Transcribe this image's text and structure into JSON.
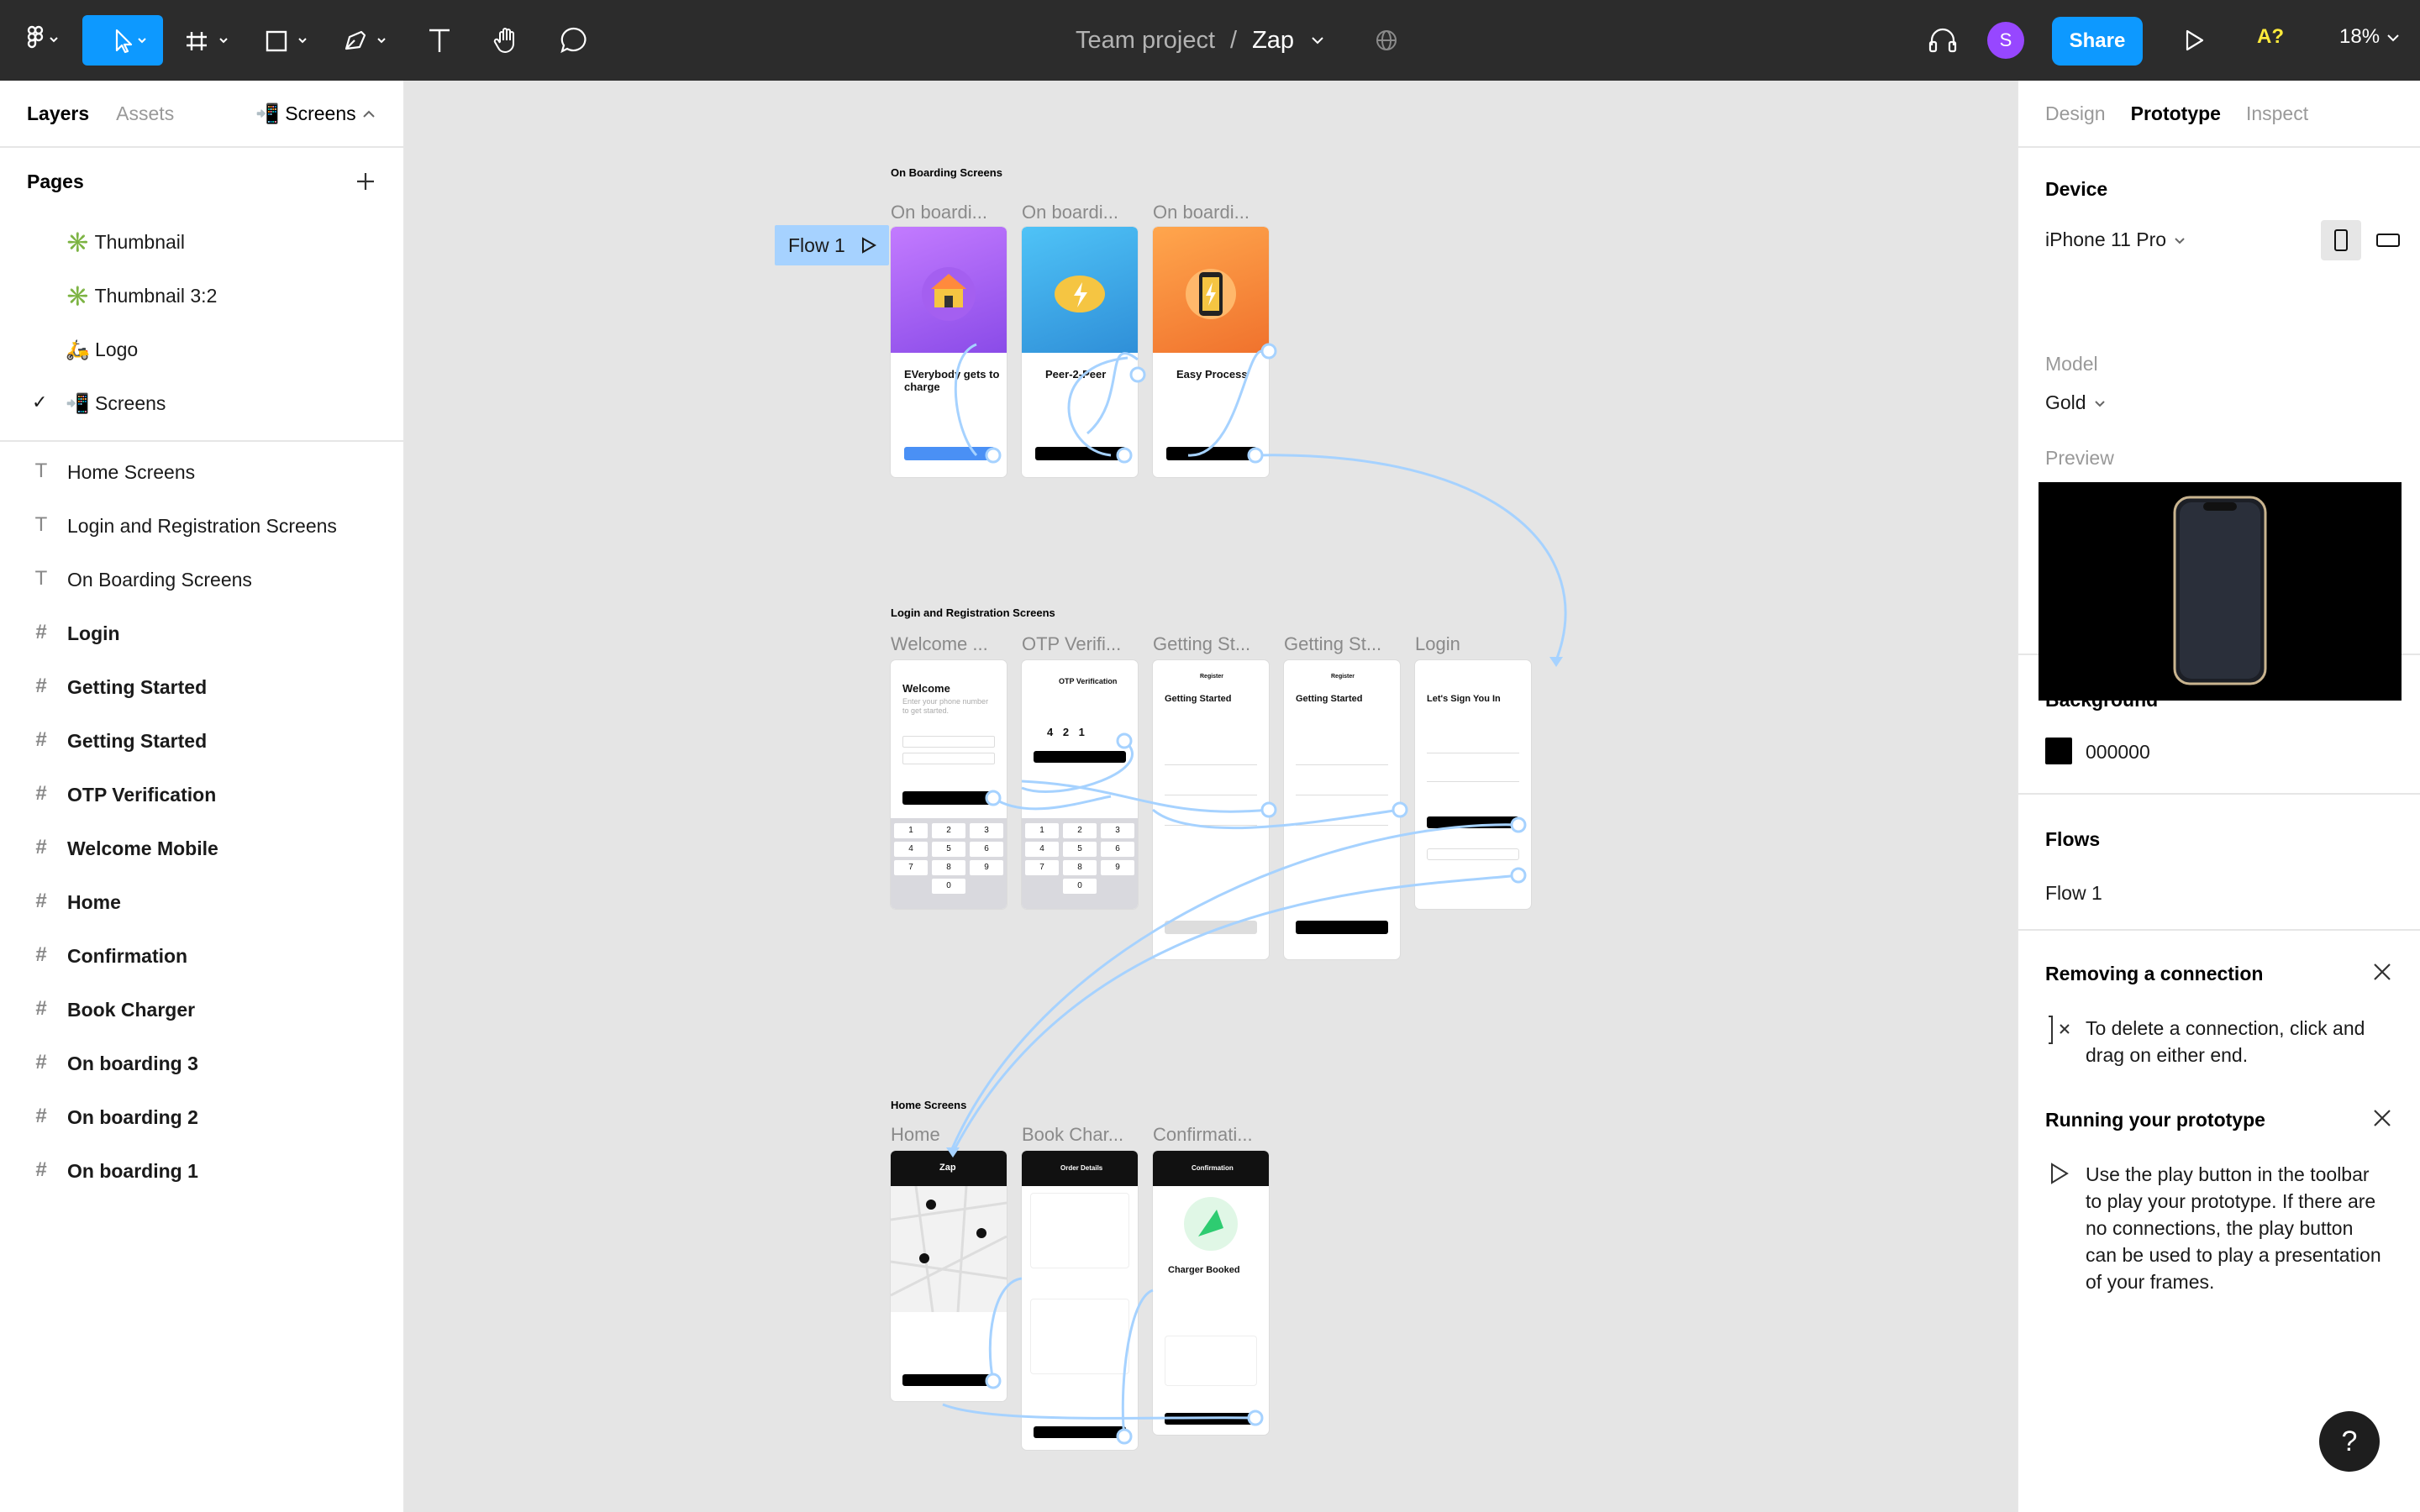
{
  "topbar": {
    "breadcrumb_team": "Team project",
    "breadcrumb_sep": "/",
    "file_name": "Zap",
    "share_label": "Share",
    "avatar_initial": "S",
    "a11y_label": "A?",
    "zoom_label": "18%"
  },
  "left_panel": {
    "tab_layers": "Layers",
    "tab_assets": "Assets",
    "page_selector": "📲 Screens",
    "pages_heading": "Pages",
    "pages": [
      {
        "label": "✳️ Thumbnail",
        "active": false
      },
      {
        "label": "✳️ Thumbnail 3:2",
        "active": false
      },
      {
        "label": "🛵 Logo",
        "active": false
      },
      {
        "label": "📲 Screens",
        "active": true
      }
    ],
    "layers": [
      {
        "label": "Home Screens",
        "kind": "text"
      },
      {
        "label": "Login and Registration Screens",
        "kind": "text"
      },
      {
        "label": "On Boarding Screens",
        "kind": "text"
      },
      {
        "label": "Login",
        "kind": "frame"
      },
      {
        "label": "Getting Started",
        "kind": "frame"
      },
      {
        "label": "Getting Started",
        "kind": "frame"
      },
      {
        "label": "OTP Verification",
        "kind": "frame"
      },
      {
        "label": "Welcome Mobile",
        "kind": "frame"
      },
      {
        "label": "Home",
        "kind": "frame"
      },
      {
        "label": "Confirmation",
        "kind": "frame"
      },
      {
        "label": "Book Charger",
        "kind": "frame"
      },
      {
        "label": "On boarding 3",
        "kind": "frame"
      },
      {
        "label": "On boarding 2",
        "kind": "frame"
      },
      {
        "label": "On boarding 1",
        "kind": "frame"
      }
    ]
  },
  "canvas": {
    "flow_chip": "Flow 1",
    "sections": {
      "onboarding": "On Boarding Screens",
      "login": "Login and Registration Screens",
      "home": "Home Screens"
    },
    "frame_labels": {
      "ob1": "On boardi...",
      "ob2": "On boardi...",
      "ob3": "On boardi...",
      "welcome": "Welcome ...",
      "otp": "OTP Verifi...",
      "gs1": "Getting St...",
      "gs2": "Getting St...",
      "login": "Login",
      "home": "Home",
      "book": "Book Char...",
      "confirm": "Confirmati..."
    },
    "screen_text": {
      "ob1_title": "EVerybody gets to charge",
      "ob2_title": "Peer-2-Peer",
      "ob3_title": "Easy Process",
      "welcome_title": "Welcome",
      "welcome_sub": "Enter your phone number to get started.",
      "otp_title": "OTP Verification",
      "otp_digits": "4 2 1",
      "gs_title": "Getting Started",
      "register_title": "Register",
      "login_title": "Let's Sign You In",
      "home_brand": "Zap",
      "order_title": "Order Details",
      "confirm_header": "Confirmation",
      "confirm_title": "Charger Booked"
    }
  },
  "right_panel": {
    "tab_design": "Design",
    "tab_prototype": "Prototype",
    "tab_inspect": "Inspect",
    "device_heading": "Device",
    "device_value": "iPhone 11 Pro",
    "model_label": "Model",
    "model_value": "Gold",
    "preview_label": "Preview",
    "background_heading": "Background",
    "background_hex": "000000",
    "flows_heading": "Flows",
    "flow_name": "Flow 1",
    "removing_heading": "Removing a connection",
    "removing_body": "To delete a connection, click and drag on either end.",
    "running_heading": "Running your prototype",
    "running_body": "Use the play button in the toolbar to play your prototype. If there are no connections, the play button can be used to play a presentation of your frames."
  },
  "help_label": "?",
  "colors": {
    "toolbar": "#2c2c2c",
    "accent": "#0d99ff",
    "connector": "#a6d2ff",
    "avatar": "#9747ff"
  }
}
